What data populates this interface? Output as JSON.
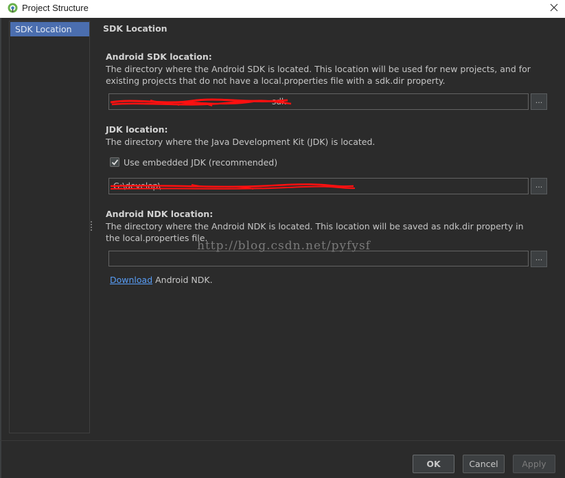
{
  "window": {
    "title": "Project Structure"
  },
  "sidebar": {
    "items": [
      {
        "label": "SDK Location"
      }
    ]
  },
  "panel": {
    "title": "SDK Location",
    "android_sdk": {
      "heading": "Android SDK location:",
      "description": "The directory where the Android SDK is located. This location will be used for new projects, and for existing projects that do not have a local.properties file with a sdk.dir property.",
      "path_visible_end": "sdk",
      "browse_label": "..."
    },
    "jdk": {
      "heading": "JDK location:",
      "description": "The directory where the Java Development Kit (JDK) is located.",
      "use_embedded_label": "Use embedded JDK (recommended)",
      "use_embedded_checked": true,
      "path_visible_start": "G:\\develop\\",
      "browse_label": "..."
    },
    "android_ndk": {
      "heading": "Android NDK location:",
      "description": "The directory where the Android NDK is located. This location will be saved as ndk.dir property in the local.properties file.",
      "path_value": "",
      "browse_label": "...",
      "download_link": "Download",
      "download_suffix": " Android NDK."
    }
  },
  "watermark": "http://blog.csdn.net/pyfysf",
  "footer": {
    "ok_label": "OK",
    "cancel_label": "Cancel",
    "apply_label": "Apply"
  },
  "colors": {
    "background": "#2b2b2b",
    "selection": "#4b6eaf",
    "link": "#589df6",
    "redaction": "#ff0000"
  }
}
